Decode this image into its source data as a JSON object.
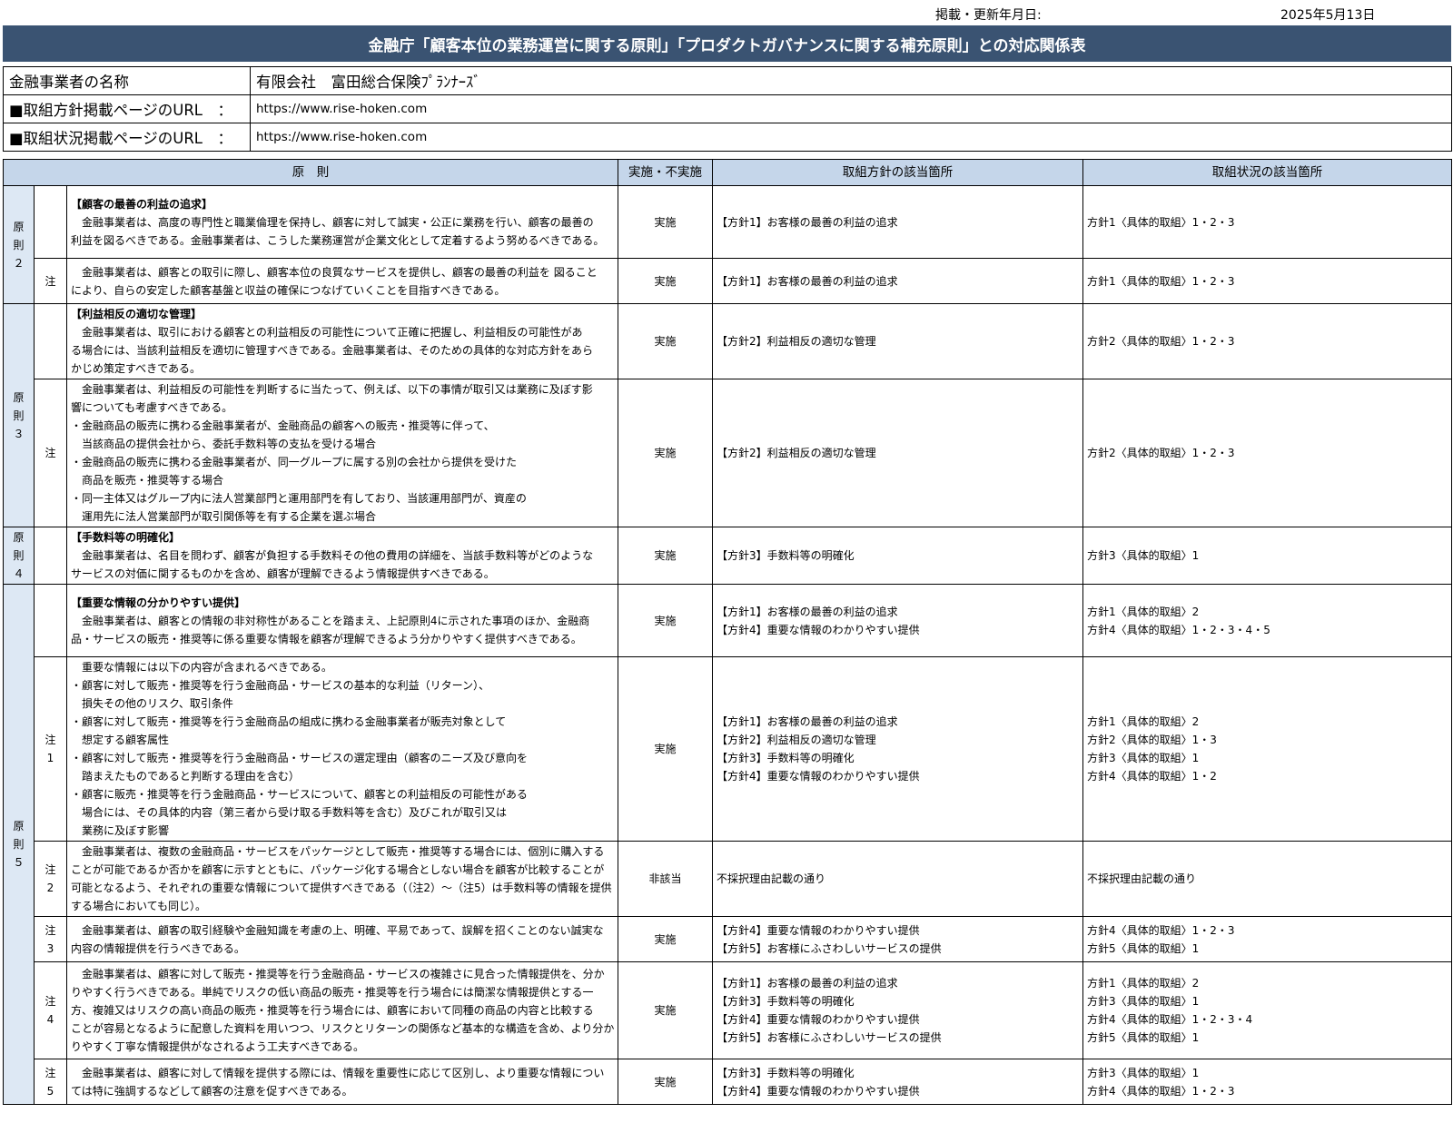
{
  "header": {
    "date_label": "掲載・更新年月日:",
    "date_value": "2025年5月13日",
    "title": "金融庁「顧客本位の業務運営に関する原則」「プロダクトガバナンスに関する補充原則」との対応関係表"
  },
  "info": {
    "company_label": "金融事業者の名称",
    "company_value": "有限会社　富田総合保険ﾌﾟﾗﾝﾅｰｽﾞ",
    "policy_url_label": "■取組方針掲載ページのURL　：",
    "policy_url_value": "https://www.rise-hoken.com",
    "status_url_label": "■取組状況掲載ページのURL　：",
    "status_url_value": "https://www.rise-hoken.com"
  },
  "columns": {
    "principle": "原　則",
    "implementation": "実施・不実施",
    "policy": "取組方針の該当箇所",
    "status": "取組状況の該当箇所"
  },
  "groups": {
    "p2": "原\n則\n２",
    "p3": "原\n則\n３",
    "p4": "原\n則\n４",
    "p5": "原\n則\n５"
  },
  "rows": {
    "p2_main": {
      "title": "【顧客の最善の利益の追求】",
      "lines": [
        "　金融事業者は、高度の専門性と職業倫理を保持し、顧客に対して誠実・公正に業務を行い、顧客の最善の",
        "利益を図るべきである。金融事業者は、こうした業務運営が企業文化として定着するよう努めるべきである。"
      ],
      "implementation": "実施",
      "policy": [
        "【方針1】お客様の最善の利益の追求"
      ],
      "status": [
        "方針1〈具体的取組〉1・2・3"
      ]
    },
    "p2_note": {
      "label": "注",
      "lines": [
        "　金融事業者は、顧客との取引に際し、顧客本位の良質なサービスを提供し、顧客の最善の利益を 図ること",
        "により、自らの安定した顧客基盤と収益の確保につなげていくことを目指すべきである。"
      ],
      "implementation": "実施",
      "policy": [
        "【方針1】お客様の最善の利益の追求"
      ],
      "status": [
        "方針1〈具体的取組〉1・2・3"
      ]
    },
    "p3_main": {
      "title": "【利益相反の適切な管理】",
      "lines": [
        "　金融事業者は、取引における顧客との利益相反の可能性について正確に把握し、利益相反の可能性があ",
        "る場合には、当該利益相反を適切に管理すべきである。金融事業者は、そのための具体的な対応方針をあら",
        "かじめ策定すべきである。"
      ],
      "implementation": "実施",
      "policy": [
        "【方針2】利益相反の適切な管理"
      ],
      "status": [
        "方針2〈具体的取組〉1・2・3"
      ]
    },
    "p3_note": {
      "label": "注",
      "lines": [
        "　金融事業者は、利益相反の可能性を判断するに当たって、例えば、以下の事情が取引又は業務に及ぼす影",
        "響についても考慮すべきである。",
        "・金融商品の販売に携わる金融事業者が、金融商品の顧客への販売・推奨等に伴って、",
        "　当該商品の提供会社から、委託手数料等の支払を受ける場合",
        "・金融商品の販売に携わる金融事業者が、同一グループに属する別の会社から提供を受けた",
        "　商品を販売・推奨等する場合",
        "・同一主体又はグループ内に法人営業部門と運用部門を有しており、当該運用部門が、資産の",
        "　運用先に法人営業部門が取引関係等を有する企業を選ぶ場合"
      ],
      "implementation": "実施",
      "policy": [
        "【方針2】利益相反の適切な管理"
      ],
      "status": [
        "方針2〈具体的取組〉1・2・3"
      ]
    },
    "p4_main": {
      "title": "【手数料等の明確化】",
      "lines": [
        "　金融事業者は、名目を問わず、顧客が負担する手数料その他の費用の詳細を、当該手数料等がどのような",
        "サービスの対価に関するものかを含め、顧客が理解できるよう情報提供すべきである。"
      ],
      "implementation": "実施",
      "policy": [
        "【方針3】手数料等の明確化"
      ],
      "status": [
        "方針3〈具体的取組〉1"
      ]
    },
    "p5_main": {
      "title": "【重要な情報の分かりやすい提供】",
      "lines": [
        "　金融事業者は、顧客との情報の非対称性があることを踏まえ、上記原則4に示された事項のほか、金融商",
        "品・サービスの販売・推奨等に係る重要な情報を顧客が理解できるよう分かりやすく提供すべきである。"
      ],
      "implementation": "実施",
      "policy": [
        "【方針1】お客様の最善の利益の追求",
        "【方針4】重要な情報のわかりやすい提供"
      ],
      "status": [
        "方針1〈具体的取組〉2",
        "方針4〈具体的取組〉1・2・3・4・5"
      ]
    },
    "p5_note1": {
      "label": "注\n1",
      "lines": [
        "　重要な情報には以下の内容が含まれるべきである。",
        "・顧客に対して販売・推奨等を行う金融商品・サービスの基本的な利益（リターン）、",
        "　損失その他のリスク、取引条件",
        "・顧客に対して販売・推奨等を行う金融商品の組成に携わる金融事業者が販売対象として",
        "　想定する顧客属性",
        "・顧客に対して販売・推奨等を行う金融商品・サービスの選定理由（顧客のニーズ及び意向を",
        "　踏まえたものであると判断する理由を含む）",
        "・顧客に販売・推奨等を行う金融商品・サービスについて、顧客との利益相反の可能性がある",
        "　場合には、その具体的内容（第三者から受け取る手数料等を含む）及びこれが取引又は",
        "　業務に及ぼす影響"
      ],
      "implementation": "実施",
      "policy": [
        "【方針1】お客様の最善の利益の追求",
        "【方針2】利益相反の適切な管理",
        "【方針3】手数料等の明確化",
        "【方針4】重要な情報のわかりやすい提供"
      ],
      "status": [
        "方針1〈具体的取組〉2",
        "方針2〈具体的取組〉1・3",
        "方針3〈具体的取組〉1",
        "方針4〈具体的取組〉1・2"
      ]
    },
    "p5_note2": {
      "label": "注\n2",
      "lines": [
        "　金融事業者は、複数の金融商品・サービスをパッケージとして販売・推奨等する場合には、個別に購入する",
        "ことが可能であるか否かを顧客に示すとともに、パッケージ化する場合としない場合を顧客が比較することが",
        "可能となるよう、それぞれの重要な情報について提供すべきである（（注2）～（注5）は手数料等の情報を提供",
        "する場合においても同じ）。"
      ],
      "implementation": "非該当",
      "policy": [
        "不採択理由記載の通り"
      ],
      "status": [
        "不採択理由記載の通り"
      ]
    },
    "p5_note3": {
      "label": "注\n3",
      "lines": [
        "　金融事業者は、顧客の取引経験や金融知識を考慮の上、明確、平易であって、誤解を招くことのない誠実な",
        "内容の情報提供を行うべきである。"
      ],
      "implementation": "実施",
      "policy": [
        "【方針4】重要な情報のわかりやすい提供",
        "【方針5】お客様にふさわしいサービスの提供"
      ],
      "status": [
        "方針4〈具体的取組〉1・2・3",
        "方針5〈具体的取組〉1"
      ]
    },
    "p5_note4": {
      "label": "注\n4",
      "lines": [
        "　金融事業者は、顧客に対して販売・推奨等を行う金融商品・サービスの複雑さに見合った情報提供を、分か",
        "りやすく行うべきである。単純でリスクの低い商品の販売・推奨等を行う場合には簡潔な情報提供とする一",
        "方、複雑又はリスクの高い商品の販売・推奨等を行う場合には、顧客において同種の商品の内容と比較する",
        "ことが容易となるように配意した資料を用いつつ、リスクとリターンの関係など基本的な構造を含め、より分か",
        "りやすく丁寧な情報提供がなされるよう工夫すべきである。"
      ],
      "implementation": "実施",
      "policy": [
        "【方針1】お客様の最善の利益の追求",
        "【方針3】手数料等の明確化",
        "【方針4】重要な情報のわかりやすい提供",
        "【方針5】お客様にふさわしいサービスの提供"
      ],
      "status": [
        "方針1〈具体的取組〉2",
        "方針3〈具体的取組〉1",
        "方針4〈具体的取組〉1・2・3・4",
        "方針5〈具体的取組〉1"
      ]
    },
    "p5_note5": {
      "label": "注\n5",
      "lines": [
        "　金融事業者は、顧客に対して情報を提供する際には、情報を重要性に応じて区別し、より重要な情報につい",
        "ては特に強調するなどして顧客の注意を促すべきである。"
      ],
      "implementation": "実施",
      "policy": [
        "【方針3】手数料等の明確化",
        "【方針4】重要な情報のわかりやすい提供"
      ],
      "status": [
        "方針3〈具体的取組〉1",
        "方針4〈具体的取組〉1・2・3"
      ]
    }
  }
}
